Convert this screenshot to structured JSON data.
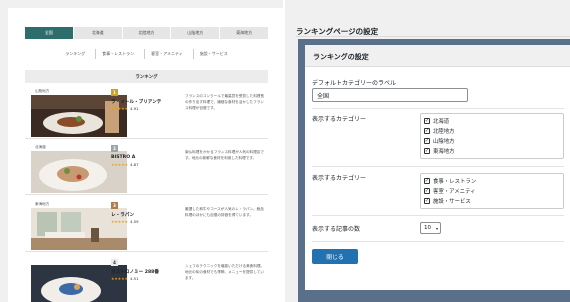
{
  "preview": {
    "region_tabs": [
      "全国",
      "北海道",
      "北陸地方",
      "山陰地方",
      "東海地方"
    ],
    "category_tabs": [
      "ランキング",
      "食事・レストラン",
      "客室・アメニティ",
      "施設・サービス"
    ],
    "ranking_header": "ランキング",
    "items": [
      {
        "area": "山陰地方",
        "rank": "1",
        "name": "ラ・メール・ブリアンテ",
        "stars": "★★★★★",
        "score": "4.91",
        "desc": "フランスのコンクールで最高賞を受賞した料理長の作り出す料理で、繊細な食材を活かしたフランス料理が自慢です。"
      },
      {
        "area": "北海道",
        "rank": "2",
        "name": "BISTRO A",
        "stars": "★★★★★",
        "score": "4.87",
        "desc": "南仏料理をかかるフランス料理が人気の料理店です。地元の新鮮な食材を利用した料理です。"
      },
      {
        "area": "東海地方",
        "rank": "3",
        "name": "レ・ラパン",
        "stars": "★★★★★",
        "score": "4.59",
        "desc": "厳選した和牛やコースが人気のレ・ラパン。絶品料理のほかにも自慢の評価を得ています。"
      },
      {
        "area": "",
        "rank": "4",
        "name": "ガストロノミー 288番",
        "stars": "★★★★★",
        "score": "4.51",
        "desc": "シェフのテクニックを堪能いただける美食料理。地元の旬の食材でも季節、メニューを提供しています。"
      }
    ]
  },
  "settings": {
    "page_title": "ランキングページの設定",
    "modal_title": "ランキングの設定",
    "default_category_label": "デフォルトカテゴリーのラベル",
    "default_category_value": "全国",
    "regions_label": "表示するカテゴリー",
    "regions": [
      {
        "label": "北海道",
        "checked": true
      },
      {
        "label": "北陸地方",
        "checked": true
      },
      {
        "label": "山陰地方",
        "checked": true
      },
      {
        "label": "東海地方",
        "checked": true
      }
    ],
    "genres_label": "表示するカテゴリー",
    "genres": [
      {
        "label": "食事・レストラン",
        "checked": true
      },
      {
        "label": "客室・アメニティ",
        "checked": true
      },
      {
        "label": "施設・サービス",
        "checked": true
      }
    ],
    "count_label": "表示する記事の数",
    "count_value": "10",
    "close_label": "閉じる"
  },
  "colors": {
    "active_tab": "#2d6d6b",
    "modal_overlay": "#5a6f8a",
    "primary_button": "#2271b1",
    "star": "#e6a11a"
  }
}
